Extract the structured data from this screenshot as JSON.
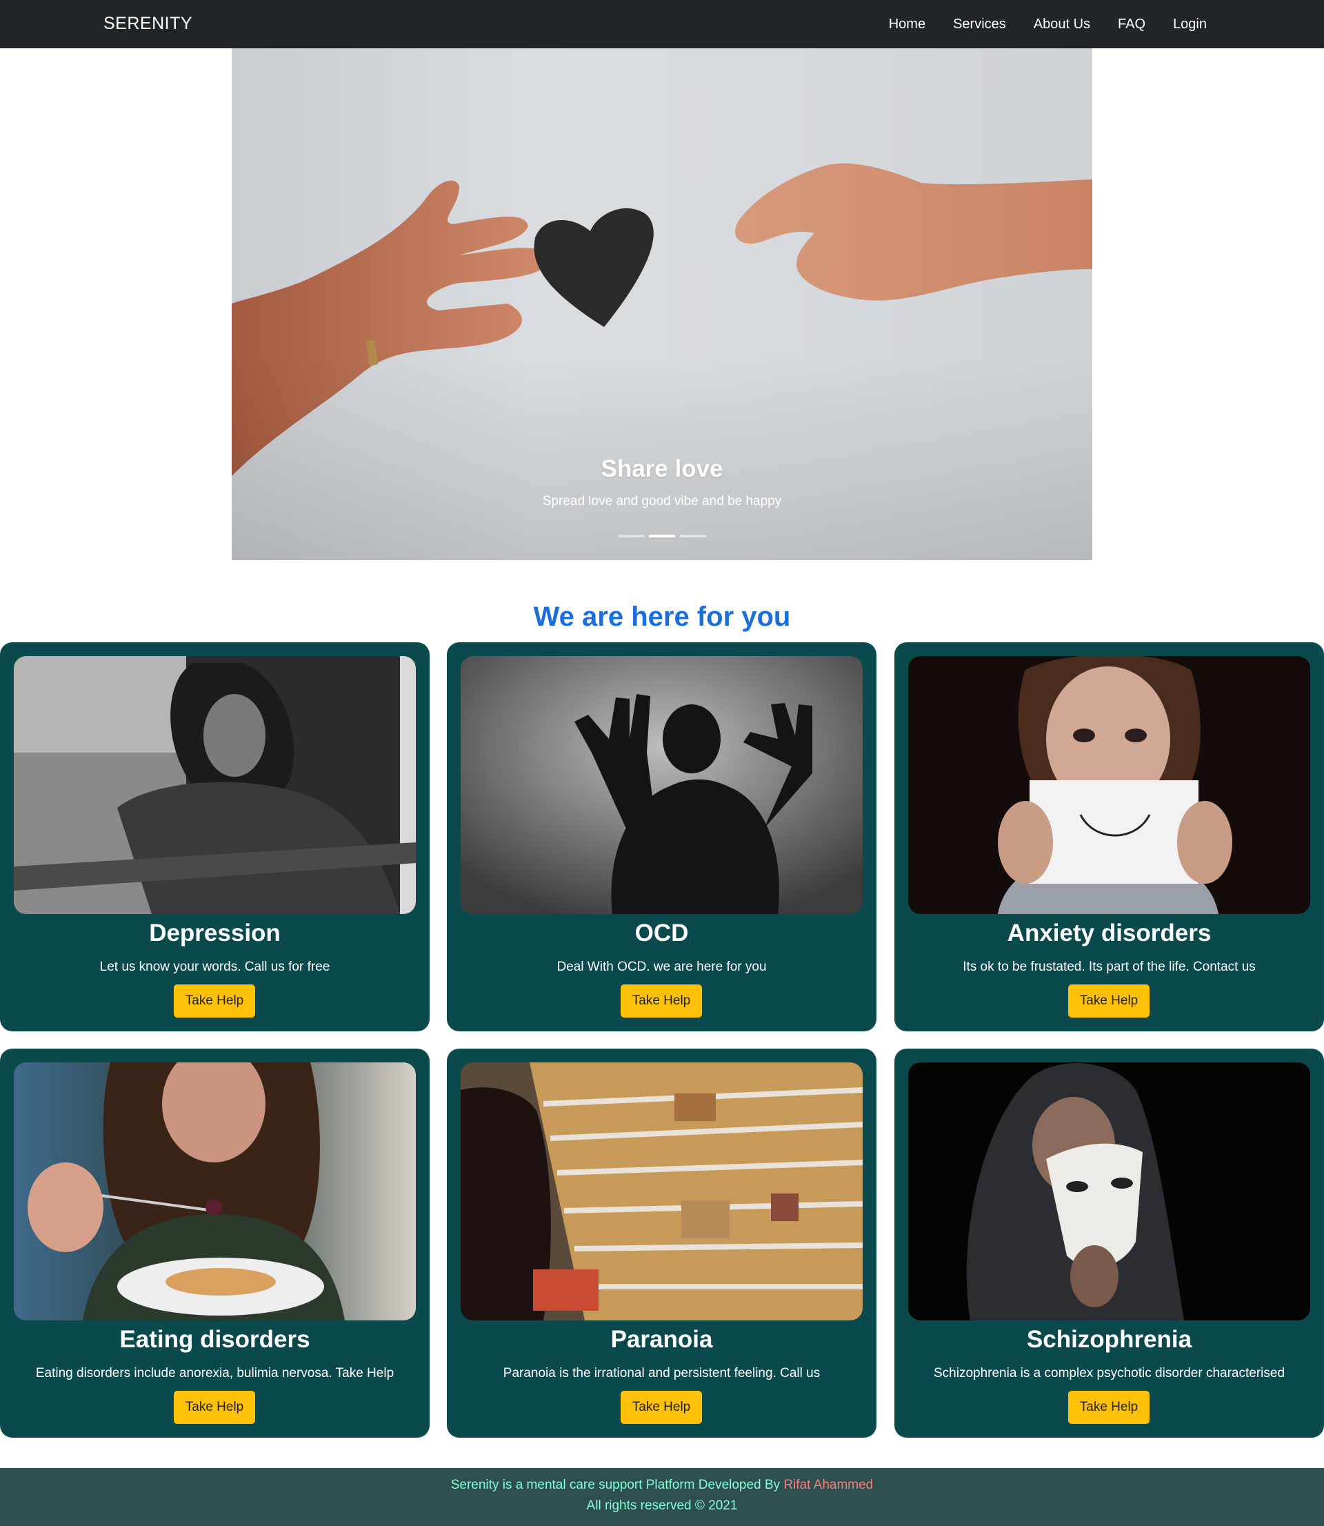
{
  "navbar": {
    "brand": "SERENITY",
    "links": [
      "Home",
      "Services",
      "About Us",
      "FAQ",
      "Login"
    ]
  },
  "hero": {
    "title": "Share love",
    "text": "Spread love and good vibe and be happy",
    "slides_count": 3,
    "active_slide": 2
  },
  "section": {
    "title": "We are here for you"
  },
  "cards": [
    {
      "title": "Depression",
      "text": "Let us know your words. Call us for free",
      "button": "Take Help"
    },
    {
      "title": "OCD",
      "text": "Deal With OCD. we are here for you",
      "button": "Take Help"
    },
    {
      "title": "Anxiety disorders",
      "text": "Its ok to be frustated. Its part of the life. Contact us",
      "button": "Take Help"
    },
    {
      "title": "Eating disorders",
      "text": "Eating disorders include anorexia, bulimia nervosa. Take Help",
      "button": "Take Help"
    },
    {
      "title": "Paranoia",
      "text": "Paranoia is the irrational and persistent feeling. Call us",
      "button": "Take Help"
    },
    {
      "title": "Schizophrenia",
      "text": "Schizophrenia is a complex psychotic disorder characterised",
      "button": "Take Help"
    }
  ],
  "footer": {
    "line1_prefix": "Serenity is a mental care support Platform Developed By",
    "author": "Rifat Ahammed",
    "line2": "All rights reserved © 2021"
  },
  "colors": {
    "navbar_bg": "#212529",
    "section_title": "#1a6fe0",
    "card_bg": "#0a4a4d",
    "button_bg": "#ffc107",
    "footer_bg": "#2f4f4f",
    "footer_text": "#7fffd4",
    "footer_author": "#f08080"
  }
}
